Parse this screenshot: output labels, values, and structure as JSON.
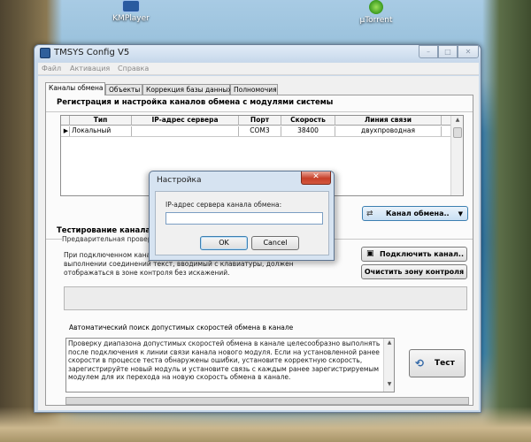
{
  "desktop": {
    "icons": [
      {
        "label": "KMPlayer"
      },
      {
        "label": "µTorrent"
      }
    ]
  },
  "window": {
    "title": "TMSYS Config V5",
    "controls": {
      "minimize": "–",
      "maximize": "□",
      "close": "✕"
    }
  },
  "menu": {
    "file": "Файл",
    "activation": "Активация",
    "help": "Справка"
  },
  "tabs": [
    {
      "label": "Каналы обмена",
      "active": true
    },
    {
      "label": "Объекты",
      "active": false
    },
    {
      "label": "Коррекция базы данных",
      "active": false
    },
    {
      "label": "Полномочия",
      "active": false
    }
  ],
  "registration": {
    "title": "Регистрация и настройка каналов обмена с модулями системы",
    "table": {
      "columns": [
        "Тип",
        "IP-адрес сервера",
        "Порт",
        "Скорость",
        "Линия связи"
      ],
      "rows": [
        {
          "indicator": "▶",
          "type": "Локальный",
          "ip": "",
          "port": "COM3",
          "speed": "38400",
          "line": "двухпроводная"
        }
      ]
    },
    "channel_button": {
      "label": "Канал обмена..",
      "icon": "channel-icon",
      "arrow": "▼"
    }
  },
  "testing": {
    "title": "Тестирование канала обмена",
    "subtitle": "Предварительная проверка канала обмена",
    "subtitle_tail": "а",
    "description": "При подключенном канале, исправном оборудовании и корректном выполнении соединений текст, вводимый с клавиатуры, должен отображаться в зоне контроля без искажений.",
    "connect_button": "Подключить канал..",
    "connect_icon": "▣",
    "clear_button": "Очистить зону контроля"
  },
  "autosearch": {
    "title": "Автоматический поиск допустимых скоростей обмена в канале",
    "text": "Проверку диапазона допустимых скоростей обмена в канале целесообразно выполнять после подключения к линии связи канала нового модуля. Если на установленной ранее скорости в процессе теста обнаружены ошибки, установите корректную скорость, зарегистрируйте новый модуль и установите связь с каждым ранее зарегистрируемым модулем для их перехода на новую скорость обмена в канале.",
    "test_button": "Тест",
    "test_icon": "⟲"
  },
  "dialog": {
    "title": "Настройка",
    "close": "✕",
    "label": "IP-адрес сервера канала обмена:",
    "input_value": "",
    "ok": "OK",
    "cancel": "Cancel"
  },
  "colors": {
    "window_frame": "#c9d9ea",
    "dialog_close": "#c7402a",
    "accent_border": "#3c7fb1"
  }
}
